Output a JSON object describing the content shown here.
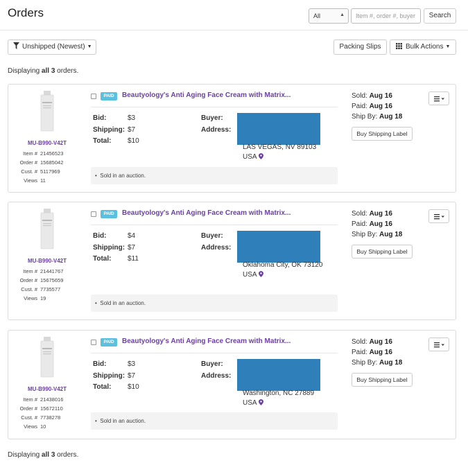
{
  "header": {
    "title": "Orders",
    "filter_selected": "All",
    "search_placeholder": "Item #, order #, buyer",
    "search_label": "Search"
  },
  "toolbar": {
    "unshipped_label": "Unshipped (Newest)",
    "packing_slips_label": "Packing Slips",
    "bulk_actions_label": "Bulk Actions"
  },
  "summary": {
    "prefix": "Displaying ",
    "count": "all 3",
    "suffix": " orders."
  },
  "colors": {
    "accent_purple": "#6b3fa0",
    "paid_badge": "#5bc0de",
    "redaction_blue": "#2f7fba"
  },
  "orders": [
    {
      "sku": "MU-B990-V42T",
      "item_no": "21456523",
      "order_no": "15685042",
      "cust_no": "5117969",
      "views": "11",
      "badge": "PAID",
      "title": "Beautyology's Anti Aging Face Cream with Matrix...",
      "bid_label": "Bid:",
      "bid": "$3",
      "shipping_label": "Shipping:",
      "shipping": "$7",
      "total_label": "Total:",
      "total": "$10",
      "buyer_label": "Buyer:",
      "address_label": "Address:",
      "city": "LAS VEGAS, NV 89103",
      "country": "USA",
      "note": "Sold in an auction.",
      "sold_label": "Sold: ",
      "sold": "Aug 16",
      "paid_label": "Paid: ",
      "paid": "Aug 16",
      "ship_by_label": "Ship By: ",
      "ship_by": "Aug 18",
      "buy_label": "Buy Shipping Label"
    },
    {
      "sku": "MU-B990-V42T",
      "item_no": "21441767",
      "order_no": "15675659",
      "cust_no": "7735577",
      "views": "19",
      "badge": "PAID",
      "title": "Beautyology's Anti Aging Face Cream with Matrix...",
      "bid_label": "Bid:",
      "bid": "$4",
      "shipping_label": "Shipping:",
      "shipping": "$7",
      "total_label": "Total:",
      "total": "$11",
      "buyer_label": "Buyer:",
      "address_label": "Address:",
      "city": "Oklahoma City, OK 73120",
      "country": "USA",
      "note": "Sold in an auction.",
      "sold_label": "Sold: ",
      "sold": "Aug 16",
      "paid_label": "Paid: ",
      "paid": "Aug 16",
      "ship_by_label": "Ship By: ",
      "ship_by": "Aug 18",
      "buy_label": "Buy Shipping Label"
    },
    {
      "sku": "MU-B990-V42T",
      "item_no": "21438016",
      "order_no": "15672110",
      "cust_no": "7738278",
      "views": "10",
      "badge": "PAID",
      "title": "Beautyology's Anti Aging Face Cream with Matrix...",
      "bid_label": "Bid:",
      "bid": "$3",
      "shipping_label": "Shipping:",
      "shipping": "$7",
      "total_label": "Total:",
      "total": "$10",
      "buyer_label": "Buyer:",
      "address_label": "Address:",
      "city": "Washington, NC 27889",
      "country": "USA",
      "note": "Sold in an auction.",
      "sold_label": "Sold: ",
      "sold": "Aug 16",
      "paid_label": "Paid: ",
      "paid": "Aug 16",
      "ship_by_label": "Ship By: ",
      "ship_by": "Aug 18",
      "buy_label": "Buy Shipping Label"
    }
  ],
  "meta_labels": {
    "item": "Item #",
    "order": "Order #",
    "cust": "Cust. #",
    "views": "Views"
  }
}
